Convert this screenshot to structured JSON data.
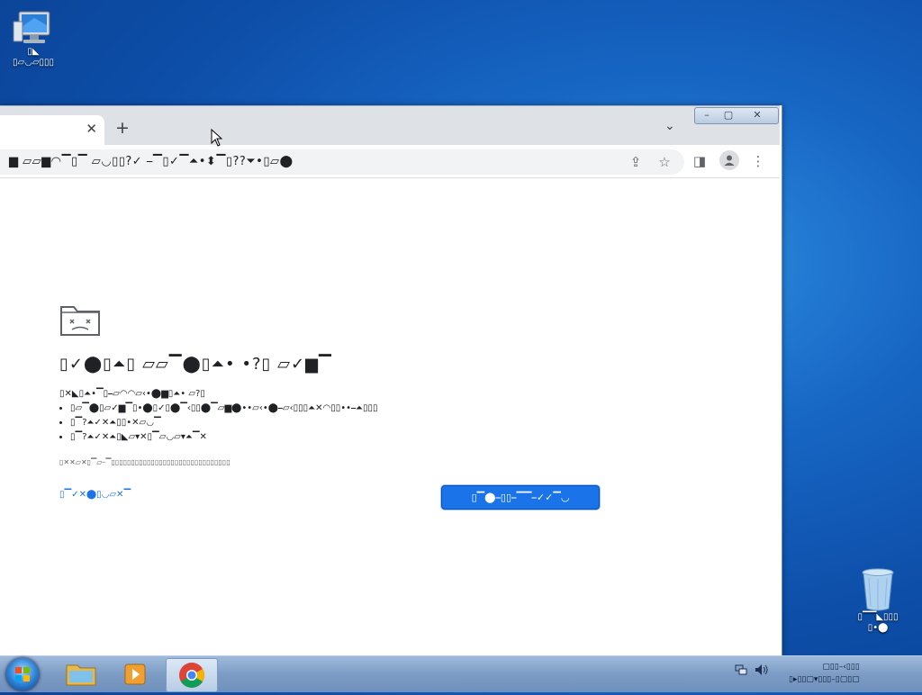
{
  "desktop": {
    "computer_icon": {
      "label_line1": "▯◣",
      "label_line2": "▯▱◡▱▯▯▯"
    },
    "recycle_icon": {
      "label_line1": "▯▔▔◣▯▯▯",
      "label_line2": "▯•⬤"
    }
  },
  "browser": {
    "tab": {
      "close": "✕"
    },
    "new_tab": "+",
    "tab_search": "⌄",
    "window_controls": {
      "minimize": "–",
      "maximize": "▢",
      "close": "✕"
    },
    "address_bar": {
      "value": "▆ ▱▱▆◠▔▯▔ ▱◡▯▯?✓ ⎯▔▯✓▔⏶•⬍▔▯??⏷•▯▱⬤"
    },
    "toolbar": {
      "share": "⇪",
      "bookmark": "☆",
      "side_panel": "◨",
      "profile": "👤",
      "menu": "⋮"
    }
  },
  "error_page": {
    "title": "▯✓⬤▯⏶▯ ▱▱▔⬤▯⏶• •?▯ ▱✓▆▔",
    "intro": "▯✕◣▯⏶•▔▯⎯▱◠◠▱‹•⬤▆▯⏶• ▱?▯",
    "bullets": [
      "▯▱▔⬤▯▱✓▆▔▯•⬤▯✓▯⬤▔‹▯▯⬤▔▱▆⬤••▱‹•⬤⎯▱‹▯▯▯⏶✕◠▯▯••⎯⏶▯▯▯",
      "▯▔?⏶✓✕⏶▯▯•✕▱◡▔",
      "▯▔?⏶✓✕⏶▯◣▱▾✕▯▔▱◡▱▾⏶▔✕"
    ],
    "error_code": "▯✕✕▱✕▯▔▱⎯▔▯▯▯▯▯▯▯▯▯▯▯▯▯▯▯▯▯▯▯▯▯▯▯▯▯▯▯▯▯▯",
    "details_link": "▯▔✓✕⬤▯◡▱✕▔",
    "reload_button": "▯▔⬤⎯▯▯⎯▔▔⎯✓✓▔◡"
  },
  "taskbar": {
    "clock_line1": "▢▯▯–‹▯▯▯",
    "clock_line2": "▯▸▯▯▢▾▯▯▯–▯▢▯▢"
  }
}
